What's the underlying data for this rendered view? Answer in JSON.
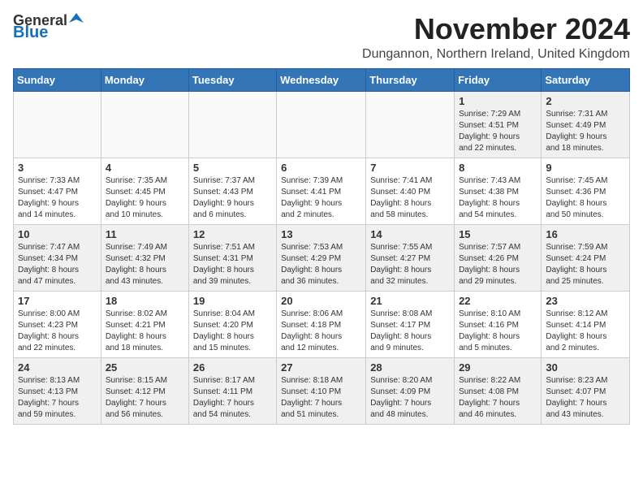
{
  "logo": {
    "general": "General",
    "blue": "Blue"
  },
  "title": "November 2024",
  "location": "Dungannon, Northern Ireland, United Kingdom",
  "days_header": [
    "Sunday",
    "Monday",
    "Tuesday",
    "Wednesday",
    "Thursday",
    "Friday",
    "Saturday"
  ],
  "weeks": [
    [
      {
        "day": "",
        "info": ""
      },
      {
        "day": "",
        "info": ""
      },
      {
        "day": "",
        "info": ""
      },
      {
        "day": "",
        "info": ""
      },
      {
        "day": "",
        "info": ""
      },
      {
        "day": "1",
        "info": "Sunrise: 7:29 AM\nSunset: 4:51 PM\nDaylight: 9 hours\nand 22 minutes."
      },
      {
        "day": "2",
        "info": "Sunrise: 7:31 AM\nSunset: 4:49 PM\nDaylight: 9 hours\nand 18 minutes."
      }
    ],
    [
      {
        "day": "3",
        "info": "Sunrise: 7:33 AM\nSunset: 4:47 PM\nDaylight: 9 hours\nand 14 minutes."
      },
      {
        "day": "4",
        "info": "Sunrise: 7:35 AM\nSunset: 4:45 PM\nDaylight: 9 hours\nand 10 minutes."
      },
      {
        "day": "5",
        "info": "Sunrise: 7:37 AM\nSunset: 4:43 PM\nDaylight: 9 hours\nand 6 minutes."
      },
      {
        "day": "6",
        "info": "Sunrise: 7:39 AM\nSunset: 4:41 PM\nDaylight: 9 hours\nand 2 minutes."
      },
      {
        "day": "7",
        "info": "Sunrise: 7:41 AM\nSunset: 4:40 PM\nDaylight: 8 hours\nand 58 minutes."
      },
      {
        "day": "8",
        "info": "Sunrise: 7:43 AM\nSunset: 4:38 PM\nDaylight: 8 hours\nand 54 minutes."
      },
      {
        "day": "9",
        "info": "Sunrise: 7:45 AM\nSunset: 4:36 PM\nDaylight: 8 hours\nand 50 minutes."
      }
    ],
    [
      {
        "day": "10",
        "info": "Sunrise: 7:47 AM\nSunset: 4:34 PM\nDaylight: 8 hours\nand 47 minutes."
      },
      {
        "day": "11",
        "info": "Sunrise: 7:49 AM\nSunset: 4:32 PM\nDaylight: 8 hours\nand 43 minutes."
      },
      {
        "day": "12",
        "info": "Sunrise: 7:51 AM\nSunset: 4:31 PM\nDaylight: 8 hours\nand 39 minutes."
      },
      {
        "day": "13",
        "info": "Sunrise: 7:53 AM\nSunset: 4:29 PM\nDaylight: 8 hours\nand 36 minutes."
      },
      {
        "day": "14",
        "info": "Sunrise: 7:55 AM\nSunset: 4:27 PM\nDaylight: 8 hours\nand 32 minutes."
      },
      {
        "day": "15",
        "info": "Sunrise: 7:57 AM\nSunset: 4:26 PM\nDaylight: 8 hours\nand 29 minutes."
      },
      {
        "day": "16",
        "info": "Sunrise: 7:59 AM\nSunset: 4:24 PM\nDaylight: 8 hours\nand 25 minutes."
      }
    ],
    [
      {
        "day": "17",
        "info": "Sunrise: 8:00 AM\nSunset: 4:23 PM\nDaylight: 8 hours\nand 22 minutes."
      },
      {
        "day": "18",
        "info": "Sunrise: 8:02 AM\nSunset: 4:21 PM\nDaylight: 8 hours\nand 18 minutes."
      },
      {
        "day": "19",
        "info": "Sunrise: 8:04 AM\nSunset: 4:20 PM\nDaylight: 8 hours\nand 15 minutes."
      },
      {
        "day": "20",
        "info": "Sunrise: 8:06 AM\nSunset: 4:18 PM\nDaylight: 8 hours\nand 12 minutes."
      },
      {
        "day": "21",
        "info": "Sunrise: 8:08 AM\nSunset: 4:17 PM\nDaylight: 8 hours\nand 9 minutes."
      },
      {
        "day": "22",
        "info": "Sunrise: 8:10 AM\nSunset: 4:16 PM\nDaylight: 8 hours\nand 5 minutes."
      },
      {
        "day": "23",
        "info": "Sunrise: 8:12 AM\nSunset: 4:14 PM\nDaylight: 8 hours\nand 2 minutes."
      }
    ],
    [
      {
        "day": "24",
        "info": "Sunrise: 8:13 AM\nSunset: 4:13 PM\nDaylight: 7 hours\nand 59 minutes."
      },
      {
        "day": "25",
        "info": "Sunrise: 8:15 AM\nSunset: 4:12 PM\nDaylight: 7 hours\nand 56 minutes."
      },
      {
        "day": "26",
        "info": "Sunrise: 8:17 AM\nSunset: 4:11 PM\nDaylight: 7 hours\nand 54 minutes."
      },
      {
        "day": "27",
        "info": "Sunrise: 8:18 AM\nSunset: 4:10 PM\nDaylight: 7 hours\nand 51 minutes."
      },
      {
        "day": "28",
        "info": "Sunrise: 8:20 AM\nSunset: 4:09 PM\nDaylight: 7 hours\nand 48 minutes."
      },
      {
        "day": "29",
        "info": "Sunrise: 8:22 AM\nSunset: 4:08 PM\nDaylight: 7 hours\nand 46 minutes."
      },
      {
        "day": "30",
        "info": "Sunrise: 8:23 AM\nSunset: 4:07 PM\nDaylight: 7 hours\nand 43 minutes."
      }
    ]
  ]
}
